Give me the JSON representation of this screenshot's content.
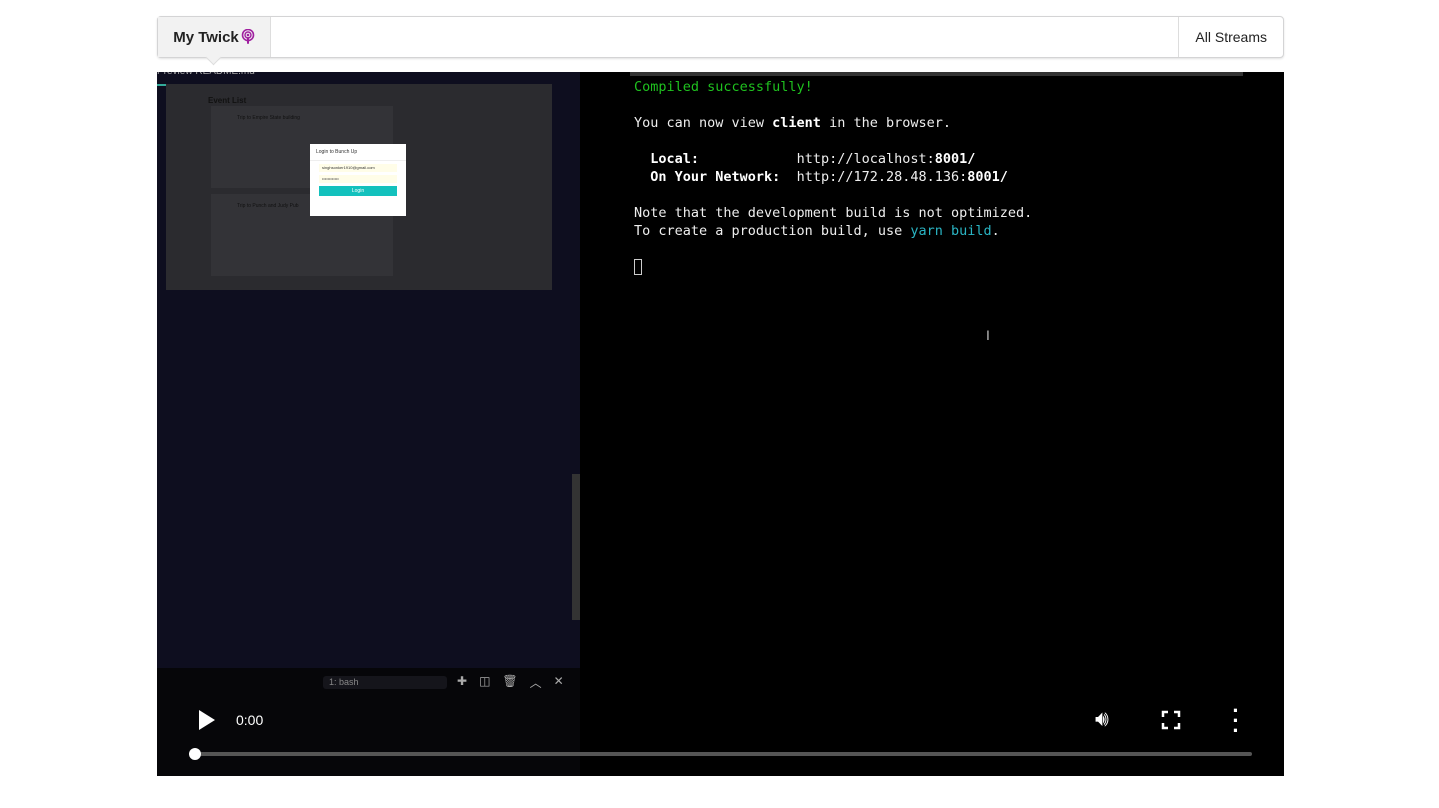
{
  "header": {
    "brand": "My Twick",
    "brand_icon": "podcast-icon",
    "brand_icon_color": "#a020a0",
    "streams_label": "All Streams"
  },
  "video": {
    "left_panel": {
      "tab_label": "Preview README.md",
      "preview": {
        "title": "Event List",
        "events": [
          {
            "title": "Trip to Empire State building"
          },
          {
            "title": "Trip to Punch and Judy Pub"
          }
        ],
        "modal": {
          "title": "Login to Bunch Up",
          "email": "singhsonker1910@gmail.com",
          "password": "••••••••••••",
          "button": "Login"
        }
      },
      "terminal_select": "1: bash"
    },
    "terminal": {
      "line1": "Compiled successfully!",
      "line2_a": "You can now view ",
      "line2_b": "client",
      "line2_c": " in the browser.",
      "local_label": "  Local:            ",
      "local_url": "http://localhost:",
      "local_port": "8001",
      "slash": "/",
      "network_label": "  On Your Network:  ",
      "network_url": "http://172.28.48.136:",
      "network_port": "8001",
      "note1": "Note that the development build is not optimized.",
      "note2_a": "To create a production build, use ",
      "note2_b": "yarn build",
      "note2_c": ".",
      "success_color": "#1fc21f",
      "link_color": "#2ab5c4"
    },
    "controls": {
      "time": "0:00",
      "progress": 0
    }
  }
}
